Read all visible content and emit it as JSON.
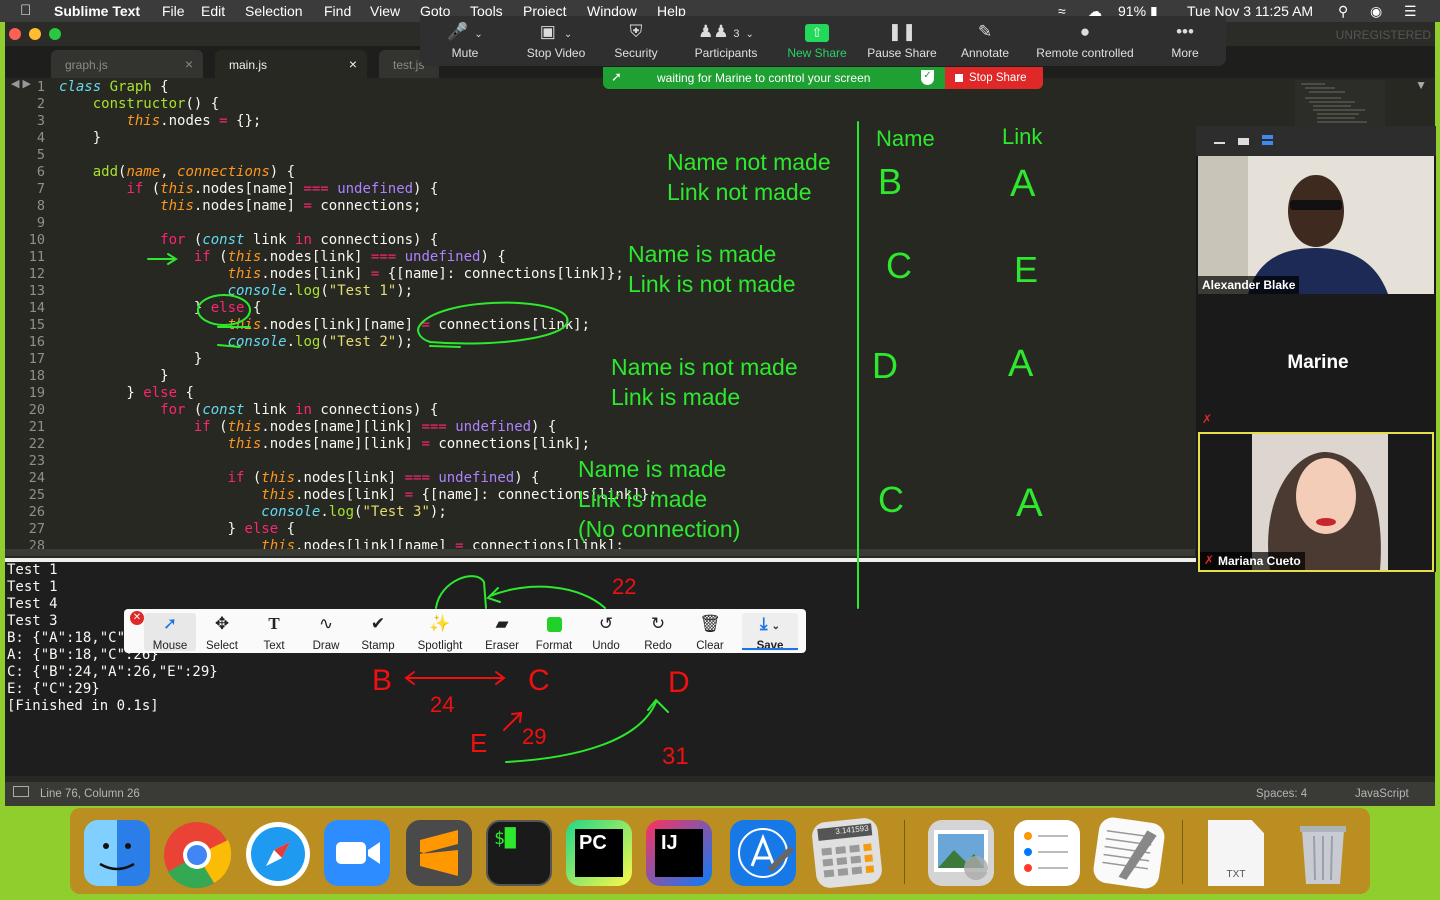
{
  "menubar": {
    "app": "Sublime Text",
    "items": [
      "File",
      "Edit",
      "Selection",
      "Find",
      "View",
      "Goto",
      "Tools",
      "Project",
      "Window",
      "Help"
    ],
    "battery": "91%",
    "datetime": "Tue Nov 3  11:25 AM"
  },
  "window": {
    "unregistered": "UNREGISTERED",
    "tabs": [
      {
        "label": "graph.js",
        "active": false
      },
      {
        "label": "main.js",
        "active": true
      },
      {
        "label": "test.js",
        "active": false
      }
    ]
  },
  "code_lines": [
    [
      {
        "t": "class",
        "c": "ty"
      },
      {
        "t": " "
      },
      {
        "t": "Graph",
        "c": "fn"
      },
      {
        "t": " {"
      }
    ],
    [
      {
        "t": "    "
      },
      {
        "t": "constructor",
        "c": "fn"
      },
      {
        "t": "() {"
      }
    ],
    [
      {
        "t": "        "
      },
      {
        "t": "this",
        "c": "th"
      },
      {
        "t": ".nodes "
      },
      {
        "t": "=",
        "c": "kw"
      },
      {
        "t": " {};"
      }
    ],
    [
      {
        "t": "    }"
      }
    ],
    [
      {
        "t": ""
      }
    ],
    [
      {
        "t": "    "
      },
      {
        "t": "add",
        "c": "fn"
      },
      {
        "t": "("
      },
      {
        "t": "name",
        "c": "pa"
      },
      {
        "t": ", "
      },
      {
        "t": "connections",
        "c": "pa"
      },
      {
        "t": ") {"
      }
    ],
    [
      {
        "t": "        "
      },
      {
        "t": "if",
        "c": "kw"
      },
      {
        "t": " ("
      },
      {
        "t": "this",
        "c": "th"
      },
      {
        "t": ".nodes[name] "
      },
      {
        "t": "===",
        "c": "kw"
      },
      {
        "t": " "
      },
      {
        "t": "undefined",
        "c": "cn"
      },
      {
        "t": ") {"
      }
    ],
    [
      {
        "t": "            "
      },
      {
        "t": "this",
        "c": "th"
      },
      {
        "t": ".nodes[name] "
      },
      {
        "t": "=",
        "c": "kw"
      },
      {
        "t": " connections;"
      }
    ],
    [
      {
        "t": ""
      }
    ],
    [
      {
        "t": "            "
      },
      {
        "t": "for",
        "c": "kw"
      },
      {
        "t": " ("
      },
      {
        "t": "const",
        "c": "ty"
      },
      {
        "t": " link "
      },
      {
        "t": "in",
        "c": "kw"
      },
      {
        "t": " connections) {"
      }
    ],
    [
      {
        "t": "                "
      },
      {
        "t": "if",
        "c": "kw"
      },
      {
        "t": " ("
      },
      {
        "t": "this",
        "c": "th"
      },
      {
        "t": ".nodes[link] "
      },
      {
        "t": "===",
        "c": "kw"
      },
      {
        "t": " "
      },
      {
        "t": "undefined",
        "c": "cn"
      },
      {
        "t": ") {"
      }
    ],
    [
      {
        "t": "                    "
      },
      {
        "t": "this",
        "c": "th"
      },
      {
        "t": ".nodes[link] "
      },
      {
        "t": "=",
        "c": "kw"
      },
      {
        "t": " {[name]: connections[link]};"
      }
    ],
    [
      {
        "t": "                    "
      },
      {
        "t": "console",
        "c": "ty"
      },
      {
        "t": "."
      },
      {
        "t": "log",
        "c": "fn"
      },
      {
        "t": "("
      },
      {
        "t": "\"Test 1\"",
        "c": "str"
      },
      {
        "t": ");"
      }
    ],
    [
      {
        "t": "                } "
      },
      {
        "t": "else",
        "c": "kw"
      },
      {
        "t": " {"
      }
    ],
    [
      {
        "t": "                    "
      },
      {
        "t": "this",
        "c": "th"
      },
      {
        "t": ".nodes[link][name] "
      },
      {
        "t": "=",
        "c": "kw"
      },
      {
        "t": " connections[link];"
      }
    ],
    [
      {
        "t": "                    "
      },
      {
        "t": "console",
        "c": "ty"
      },
      {
        "t": "."
      },
      {
        "t": "log",
        "c": "fn"
      },
      {
        "t": "("
      },
      {
        "t": "\"Test 2\"",
        "c": "str"
      },
      {
        "t": ");"
      }
    ],
    [
      {
        "t": "                }"
      }
    ],
    [
      {
        "t": "            }"
      }
    ],
    [
      {
        "t": "        } "
      },
      {
        "t": "else",
        "c": "kw"
      },
      {
        "t": " {"
      }
    ],
    [
      {
        "t": "            "
      },
      {
        "t": "for",
        "c": "kw"
      },
      {
        "t": " ("
      },
      {
        "t": "const",
        "c": "ty"
      },
      {
        "t": " link "
      },
      {
        "t": "in",
        "c": "kw"
      },
      {
        "t": " connections) {"
      }
    ],
    [
      {
        "t": "                "
      },
      {
        "t": "if",
        "c": "kw"
      },
      {
        "t": " ("
      },
      {
        "t": "this",
        "c": "th"
      },
      {
        "t": ".nodes[name][link] "
      },
      {
        "t": "===",
        "c": "kw"
      },
      {
        "t": " "
      },
      {
        "t": "undefined",
        "c": "cn"
      },
      {
        "t": ") {"
      }
    ],
    [
      {
        "t": "                    "
      },
      {
        "t": "this",
        "c": "th"
      },
      {
        "t": ".nodes[name][link] "
      },
      {
        "t": "=",
        "c": "kw"
      },
      {
        "t": " connections[link];"
      }
    ],
    [
      {
        "t": ""
      }
    ],
    [
      {
        "t": "                    "
      },
      {
        "t": "if",
        "c": "kw"
      },
      {
        "t": " ("
      },
      {
        "t": "this",
        "c": "th"
      },
      {
        "t": ".nodes[link] "
      },
      {
        "t": "===",
        "c": "kw"
      },
      {
        "t": " "
      },
      {
        "t": "undefined",
        "c": "cn"
      },
      {
        "t": ") {"
      }
    ],
    [
      {
        "t": "                        "
      },
      {
        "t": "this",
        "c": "th"
      },
      {
        "t": ".nodes[link] "
      },
      {
        "t": "=",
        "c": "kw"
      },
      {
        "t": " {[name]: connections[link]};"
      }
    ],
    [
      {
        "t": "                        "
      },
      {
        "t": "console",
        "c": "ty"
      },
      {
        "t": "."
      },
      {
        "t": "log",
        "c": "fn"
      },
      {
        "t": "("
      },
      {
        "t": "\"Test 3\"",
        "c": "str"
      },
      {
        "t": ");"
      }
    ],
    [
      {
        "t": "                    } "
      },
      {
        "t": "else",
        "c": "kw"
      },
      {
        "t": " {"
      }
    ],
    [
      {
        "t": "                        "
      },
      {
        "t": "this",
        "c": "th"
      },
      {
        "t": ".nodes[link][name] "
      },
      {
        "t": "=",
        "c": "kw"
      },
      {
        "t": " connections[link];"
      }
    ]
  ],
  "output_lines": [
    "Test 1",
    "Test 1",
    "Test 4",
    "Test 3",
    "B: {\"A\":18,\"C\":",
    "A: {\"B\":18,\"C\":26}",
    "C: {\"B\":24,\"A\":26,\"E\":29}",
    "E: {\"C\":29}",
    "[Finished in 0.1s]"
  ],
  "statusbar": {
    "position": "Line 76, Column 26",
    "spaces": "Spaces: 4",
    "syntax": "JavaScript"
  },
  "zoom": {
    "buttons": [
      {
        "label": "Mute",
        "icon": "mic-icon"
      },
      {
        "label": "Stop Video",
        "icon": "video-icon"
      },
      {
        "label": "Security",
        "icon": "shield-icon"
      },
      {
        "label": "Participants",
        "icon": "participants-icon",
        "count": "3"
      },
      {
        "label": "New Share",
        "icon": "share-icon"
      },
      {
        "label": "Pause Share",
        "icon": "pause-icon"
      },
      {
        "label": "Annotate",
        "icon": "pen-icon"
      },
      {
        "label": "Remote controlled",
        "icon": "mouse-icon"
      },
      {
        "label": "More",
        "icon": "more-icon"
      }
    ],
    "waiting": "waiting for Marine to control your screen",
    "stop_share": "Stop Share",
    "annotate_tools": [
      {
        "label": "Mouse",
        "icon": "cursor-icon"
      },
      {
        "label": "Select",
        "icon": "move-icon"
      },
      {
        "label": "Text",
        "icon": "text-icon"
      },
      {
        "label": "Draw",
        "icon": "draw-icon"
      },
      {
        "label": "Stamp",
        "icon": "check-icon"
      },
      {
        "label": "Spotlight",
        "icon": "spotlight-icon"
      },
      {
        "label": "Eraser",
        "icon": "eraser-icon"
      },
      {
        "label": "Format",
        "icon": "format-icon"
      },
      {
        "label": "Undo",
        "icon": "undo-icon"
      },
      {
        "label": "Redo",
        "icon": "redo-icon"
      },
      {
        "label": "Clear",
        "icon": "trash-icon"
      },
      {
        "label": "Save",
        "icon": "save-icon"
      }
    ],
    "participants": [
      {
        "name": "Alexander Blake"
      },
      {
        "name": "Marine"
      },
      {
        "name": "Mariana Cueto"
      }
    ]
  },
  "annotations": {
    "table_headers": [
      "Name",
      "Link"
    ],
    "table_rows": [
      [
        "B",
        "A"
      ],
      [
        "C",
        "E"
      ],
      [
        "D",
        "A"
      ],
      [
        "C",
        "A"
      ]
    ],
    "notes": [
      [
        "Name not made",
        "Link not made"
      ],
      [
        "Name is made",
        "Link is not made"
      ],
      [
        "Name is not made",
        "Link is made"
      ],
      [
        "Name is made",
        "Link is made",
        "(No connection)"
      ]
    ],
    "graph_nodes": [
      "B",
      "C",
      "D",
      "E"
    ],
    "edge_weights": [
      "22",
      "24",
      "29",
      "31"
    ]
  },
  "dock": {
    "apps": [
      "finder-icon",
      "chrome-icon",
      "safari-icon",
      "zoom-icon",
      "sublime-icon",
      "terminal-icon",
      "pycharm-icon",
      "intellij-icon",
      "xcode-icon",
      "calculator-icon",
      "preview-icon",
      "reminders-icon",
      "textedit-icon",
      "txt-file-icon",
      "trash-icon"
    ],
    "txt_label": "TXT",
    "calc_display": "3.141593"
  }
}
